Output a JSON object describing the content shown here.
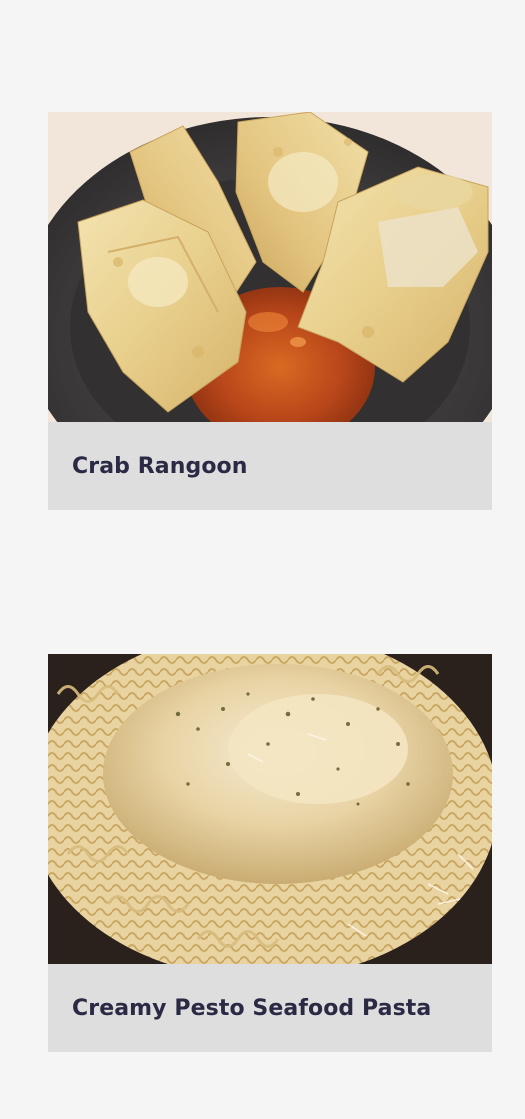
{
  "recipes": [
    {
      "title": "Crab Rangoon",
      "image_icon": "crab-rangoon-photo"
    },
    {
      "title": "Creamy Pesto Seafood Pasta",
      "image_icon": "creamy-pesto-seafood-pasta-photo"
    }
  ],
  "colors": {
    "page_background": "#f5f5f5",
    "card_caption_background": "#dedede",
    "title_text": "#2a2a45"
  }
}
